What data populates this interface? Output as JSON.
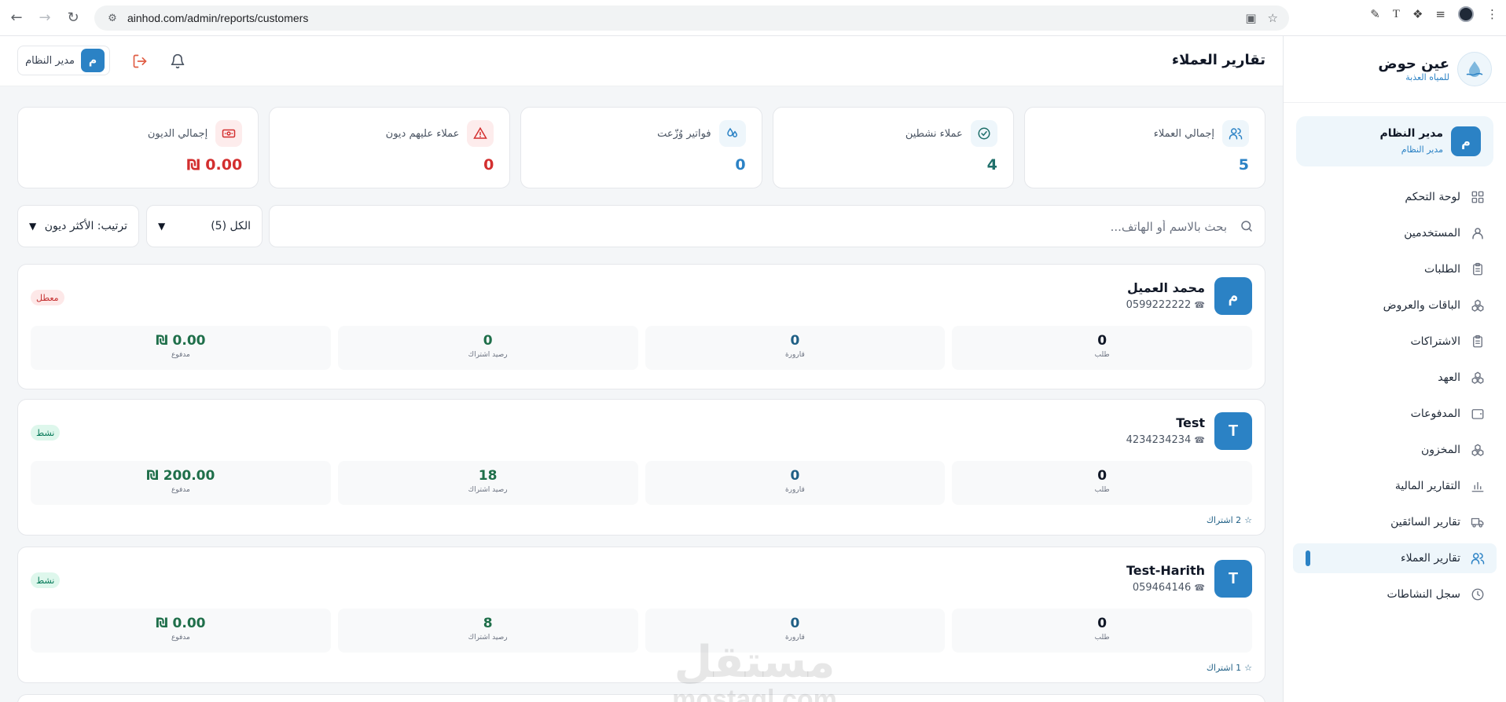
{
  "browser": {
    "url": "ainhod.com/admin/reports/customers"
  },
  "header": {
    "title": "تقارير العملاء",
    "user_name": "مدير النظام",
    "user_initial": "م"
  },
  "stats": [
    {
      "label": "إجمالي العملاء",
      "value": "5",
      "icon": "users-icon",
      "color": "#2b82c5",
      "bg": "#eef6fb"
    },
    {
      "label": "عملاء نشطين",
      "value": "4",
      "icon": "check-circle-icon",
      "color": "#1f6f6a",
      "bg": "#eef6fb"
    },
    {
      "label": "فواتير وُزّعت",
      "value": "0",
      "icon": "droplets-icon",
      "color": "#2b82c5",
      "bg": "#eef6fb"
    },
    {
      "label": "عملاء عليهم ديون",
      "value": "0",
      "icon": "warning-icon",
      "color": "#d32f2f",
      "bg": "#fdecec"
    },
    {
      "label": "إجمالي الديون",
      "value": "0.00 ₪",
      "icon": "cash-icon",
      "color": "#d32f2f",
      "bg": "#fdecec"
    }
  ],
  "filters": {
    "search_placeholder": "بحث بالاسم أو الهاتف...",
    "status_select": "الكل (5)",
    "sort_select": "ترتيب: الأكثر ديون"
  },
  "customers": [
    {
      "initial": "م",
      "name": "محمد العميل",
      "phone": "0599222222",
      "status": "معطل",
      "metrics": [
        {
          "value": "0",
          "label": "طلب"
        },
        {
          "value": "0",
          "label": "قارورة"
        },
        {
          "value": "0",
          "label": "رصيد اشتراك"
        },
        {
          "value": "0.00 ₪",
          "label": "مدفوع"
        }
      ],
      "subscriptions": ""
    },
    {
      "initial": "T",
      "name": "Test",
      "phone": "4234234234",
      "status": "نشط",
      "metrics": [
        {
          "value": "0",
          "label": "طلب"
        },
        {
          "value": "0",
          "label": "قارورة"
        },
        {
          "value": "18",
          "label": "رصيد اشتراك"
        },
        {
          "value": "200.00 ₪",
          "label": "مدفوع"
        }
      ],
      "subscriptions": "2 اشتراك"
    },
    {
      "initial": "T",
      "name": "Test-Harith",
      "phone": "059464146",
      "status": "نشط",
      "metrics": [
        {
          "value": "0",
          "label": "طلب"
        },
        {
          "value": "0",
          "label": "قارورة"
        },
        {
          "value": "8",
          "label": "رصيد اشتراك"
        },
        {
          "value": "0.00 ₪",
          "label": "مدفوع"
        }
      ],
      "subscriptions": "1 اشتراك"
    }
  ],
  "sidebar": {
    "brand_title": "عين حوض",
    "brand_subtitle": "للمياه العذبة",
    "user_name": "مدير النظام",
    "user_role": "مدير النظام",
    "user_initial": "م",
    "items": [
      {
        "label": "لوحة التحكم",
        "icon": "dashboard-grid-icon"
      },
      {
        "label": "المستخدمين",
        "icon": "user-icon"
      },
      {
        "label": "الطلبات",
        "icon": "clipboard-icon"
      },
      {
        "label": "الباقات والعروض",
        "icon": "boxes-icon"
      },
      {
        "label": "الاشتراكات",
        "icon": "clipboard-icon"
      },
      {
        "label": "العهد",
        "icon": "boxes-icon"
      },
      {
        "label": "المدفوعات",
        "icon": "wallet-icon"
      },
      {
        "label": "المخزون",
        "icon": "boxes-icon"
      },
      {
        "label": "التقارير المالية",
        "icon": "bar-chart-icon"
      },
      {
        "label": "تقارير السائقين",
        "icon": "truck-icon"
      },
      {
        "label": "تقارير العملاء",
        "icon": "users-icon"
      },
      {
        "label": "سجل النشاطات",
        "icon": "clock-icon"
      }
    ],
    "active_index": 10
  },
  "watermark": {
    "line1": "مستقل",
    "line2": "mostaql.com"
  },
  "colors": {
    "accent": "#2b82c5",
    "danger": "#d32f2f",
    "success": "#1f6f4a"
  }
}
